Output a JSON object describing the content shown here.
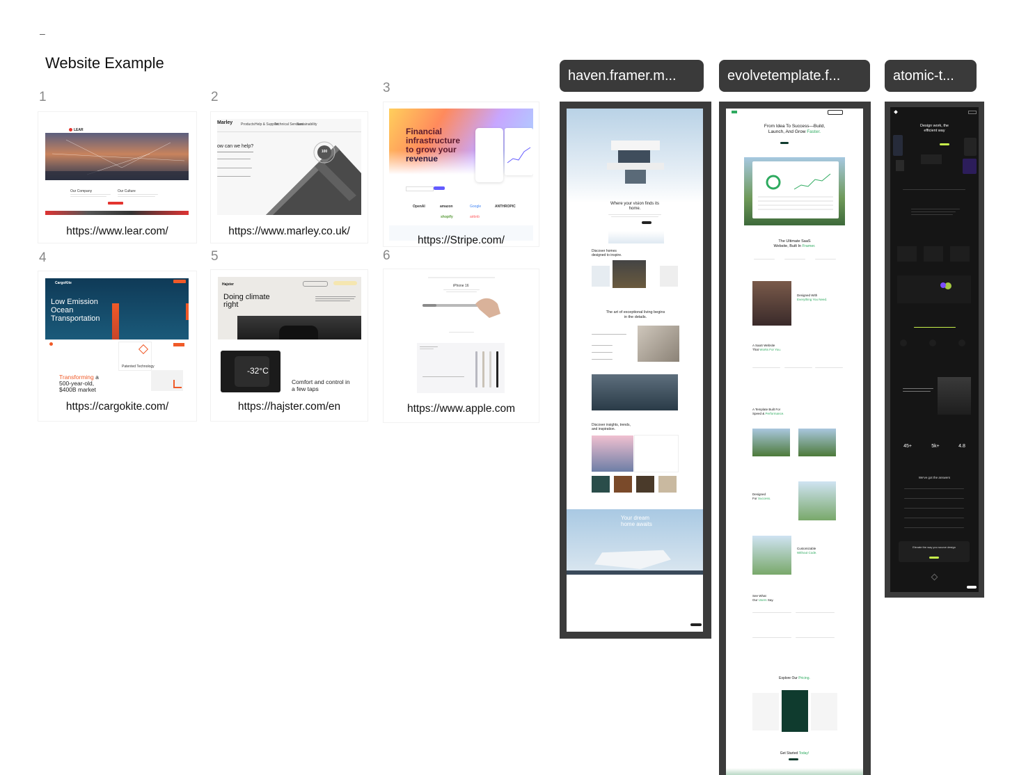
{
  "canvas": {
    "minimize_label": "–",
    "section_title": "Website Example"
  },
  "cards": [
    {
      "number": "1",
      "url": "https://www.lear.com/",
      "thumb": {
        "logo": "LEAR",
        "left_text": "Our Company",
        "right_text": "Our Culture"
      }
    },
    {
      "number": "2",
      "url": "https://www.marley.co.uk/",
      "thumb": {
        "logo": "Marley",
        "nav": [
          "Products",
          "Help & Support",
          "Technical Services",
          "Sustainability"
        ],
        "search_prompt": "ow can we help?",
        "badge": "100"
      }
    },
    {
      "number": "3",
      "url": "https://Stripe.com/",
      "thumb": {
        "headline_1": "Financial",
        "headline_2": "infrastructure",
        "headline_3": "to grow your",
        "headline_4": "revenue",
        "logos": [
          "OpenAI",
          "amazon",
          "Google",
          "ANTHROPIC",
          "shopify",
          "airbnb"
        ]
      }
    },
    {
      "number": "4",
      "url": "https://cargokite.com/",
      "thumb": {
        "logo": "CargoKite",
        "headline_1": "Low Emission",
        "headline_2": "Ocean",
        "headline_3": "Transportation",
        "accent": "Transforming",
        "tail": "a",
        "line_2": "500-year-old,",
        "line_3": "$400B market",
        "tile_label": "Patented Technology"
      }
    },
    {
      "number": "5",
      "url": "https://hajster.com/en",
      "thumb": {
        "logo": "Hajster",
        "headline_1": "Doing climate",
        "headline_2": "right",
        "temp": "-32°C",
        "caption_1": "Comfort and control in",
        "caption_2": "a few taps"
      }
    },
    {
      "number": "6",
      "url": "https://www.apple.com",
      "thumb": {
        "caption": "iPhone 16"
      }
    }
  ],
  "frames": [
    {
      "label": "haven.framer.m...",
      "content": {
        "hero": "Where your vision finds its home.",
        "section_1": "Discover homes designed to inspire.",
        "section_2": "The art of exceptional living begins in the details.",
        "section_3": "Discover insights, trends, and inspiration.",
        "cta_1": "Your dream",
        "cta_2": "home awaits"
      }
    },
    {
      "label": "evolvetemplate.f...",
      "content": {
        "hero_1": "From Idea To Success—Build,",
        "hero_2": "Launch, And Grow",
        "hero_accent": "Faster.",
        "s1": "The Ultimate SaaS",
        "s1b": "Website, Built In",
        "s1_accent": "Framer.",
        "s2": "Designed With",
        "s2_accent": "Everything You Need.",
        "s3": "A SaaS Website",
        "s3b": "That",
        "s3_accent": "Works For You.",
        "s4": "A Template Built For",
        "s4b": "Speed &",
        "s4_accent": "Performance.",
        "s5": "Designed",
        "s5b": "For",
        "s5_accent": "Success.",
        "s6": "Customizable",
        "s6_accent": "Without Code.",
        "s7": "See What",
        "s7b": "Our",
        "s7_accent": "Users",
        "s7c": "Say.",
        "s8": "Explore Our",
        "s8_accent": "Pricing.",
        "s9": "Get Started",
        "s9_accent": "Today!"
      }
    },
    {
      "label": "atomic-t...",
      "content": {
        "hero_1": "Design work, the",
        "hero_2": "efficient way",
        "stat_1": "45+",
        "stat_2": "5k+",
        "stat_3": "4.8",
        "faq": "We've got the answers",
        "cta": "Elevate the way you source design"
      }
    }
  ],
  "colors": {
    "accent_green": "#2eaa5f",
    "evolve_dark": "#0f3b2e",
    "atomic_lime": "#c8f24b",
    "cargokite_orange": "#f05a28",
    "stripe_purple": "#635bff",
    "lear_red": "#e3342f"
  }
}
